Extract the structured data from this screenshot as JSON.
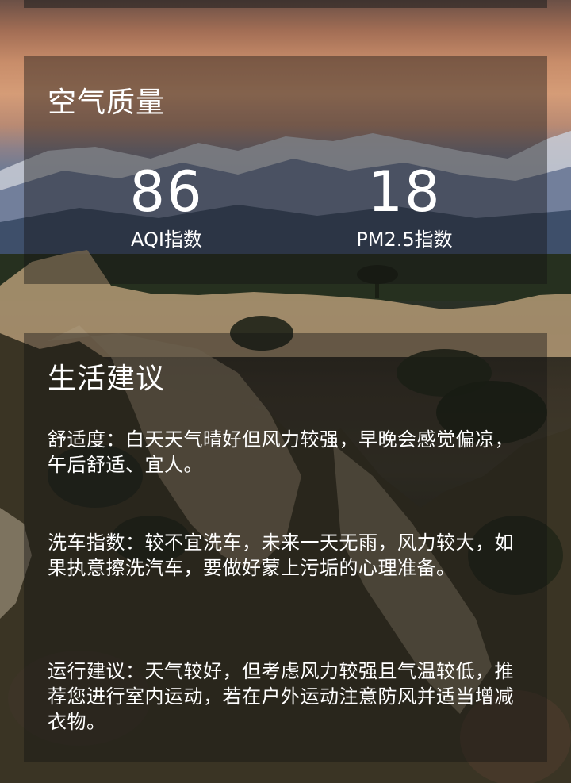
{
  "air_quality": {
    "title": "空气质量",
    "aqi_value": "86",
    "aqi_label": "AQI指数",
    "pm25_value": "18",
    "pm25_label": "PM2.5指数"
  },
  "life_advice": {
    "title": "生活建议",
    "comfort": "舒适度：白天天气晴好但风力较强，早晚会感觉偏凉，午后舒适、宜人。",
    "car_wash": "洗车指数：较不宜洗车，未来一天无雨，风力较大，如果执意擦洗汽车，要做好蒙上污垢的心理准备。",
    "sport": "运行建议：天气较好，但考虑风力较强且气温较低，推荐您进行室内运动，若在户外运动注意防风并适当增减衣物。"
  }
}
